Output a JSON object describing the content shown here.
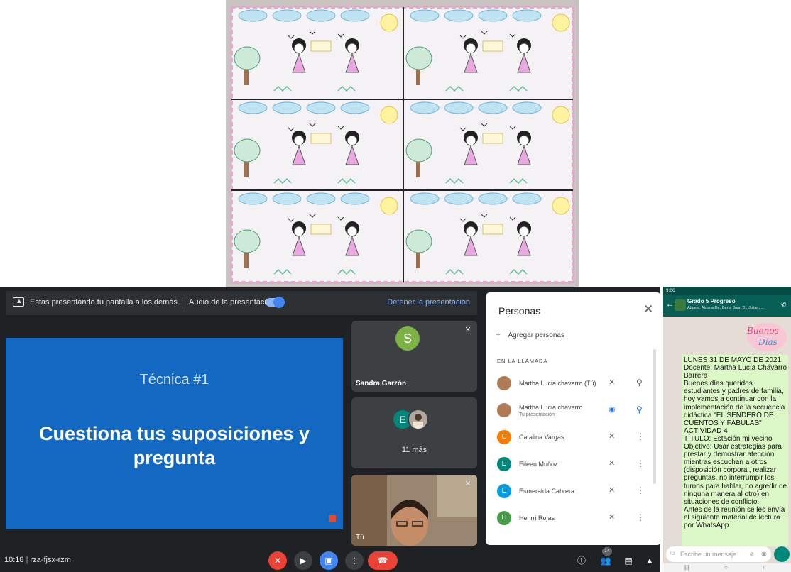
{
  "presentation_banner": {
    "presenting_text": "Estás presentando tu pantalla a los demás",
    "audio_label": "Audio de la presentación",
    "stop_label": "Detener la presentación"
  },
  "slide": {
    "subtitle": "Técnica #1",
    "title": "Cuestiona tus suposiciones y pregunta"
  },
  "tiles": {
    "tile1": {
      "initial": "S",
      "name": "Sandra Garzón"
    },
    "tile2": {
      "initial": "E",
      "more_label": "11 más"
    },
    "tile3": {
      "name": "Tú"
    }
  },
  "meeting": {
    "time": "10:18",
    "code": "rza-fjsx-rzm",
    "participants_badge": "14"
  },
  "people_panel": {
    "title": "Personas",
    "add_label": "Agregar personas",
    "section_label": "EN LA LLAMADA",
    "participants": [
      {
        "initial": "",
        "name": "Martha Lucia chavarro (Tú)",
        "sub": "",
        "color": "#b07a55"
      },
      {
        "initial": "",
        "name": "Martha Lucia chavarro",
        "sub": "Tu presentación",
        "color": "#b07a55"
      },
      {
        "initial": "C",
        "name": "Catalina Vargas",
        "sub": "",
        "color": "#f57c00"
      },
      {
        "initial": "E",
        "name": "Eileen Muñoz",
        "sub": "",
        "color": "#00897b"
      },
      {
        "initial": "E",
        "name": "Esmeralda Cabrera",
        "sub": "",
        "color": "#039be5"
      },
      {
        "initial": "H",
        "name": "Henrri Rojas",
        "sub": "",
        "color": "#43a047"
      }
    ]
  },
  "whatsapp": {
    "status_time": "9:06",
    "group_name": "Grado 5 Progreso",
    "members": "Abuela, Abuela De, Derly, Juan D., Julian, ...",
    "sticker_text": "Buenos Días",
    "message": "LUNES 31 DE MAYO DE 2021\nDocente: Martha Lucía Chávarro Barrera\nBuenos días queridos estudiantes y padres de familia, hoy vamos a continuar con la implementación de la secuencia didáctica \"EL SENDERO DE CUENTOS Y FÁBULAS\"\nACTIVIDAD 4\nTÍTULO: Estación mi vecino\nObjetivo: Usar estrategias para prestar y demostrar atención mientras escuchan a otros (disposición corporal, realizar preguntas, no interrumpir los turnos para hablar, no agredir de ninguna manera al otro) en situaciones de conflicto.\nAntes de la reunión se les envía el siguiente material de lectura por WhatsApp",
    "input_placeholder": "Escribe un mensaje"
  }
}
